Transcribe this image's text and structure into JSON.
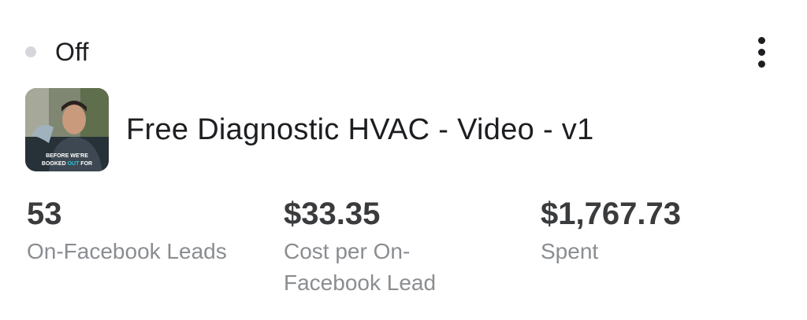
{
  "status": {
    "label": "Off",
    "dot_color": "#d6d7da"
  },
  "menu": {
    "icon": "more-vertical-icon"
  },
  "ad": {
    "name": "Free Diagnostic HVAC - Video - v1",
    "thumbnail": {
      "icon": "video-thumbnail",
      "caption_line1": "BEFORE WE'RE",
      "caption_line2_part1": "BOOKED ",
      "caption_line2_highlight": "OUT",
      "caption_line2_part2": " FOR"
    }
  },
  "metrics": [
    {
      "value": "53",
      "label": "On-Facebook Leads"
    },
    {
      "value": "$33.35",
      "label": "Cost per On-Facebook Lead"
    },
    {
      "value": "$1,767.73",
      "label": "Spent"
    }
  ]
}
